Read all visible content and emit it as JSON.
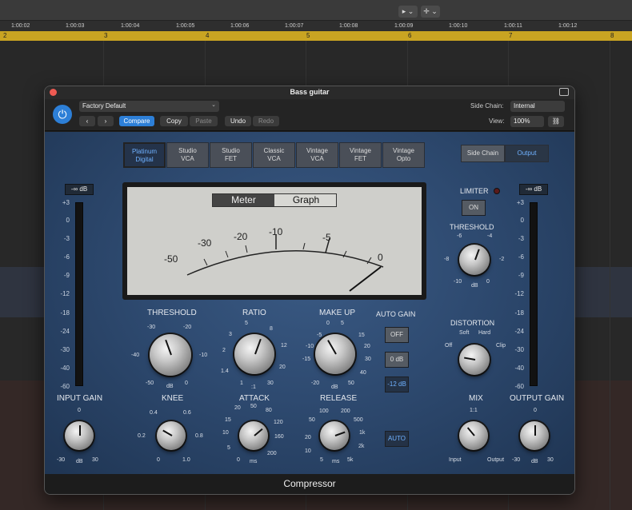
{
  "daw": {
    "tools": [
      "▸ ⌄",
      "✛ ⌄"
    ],
    "timecodes": [
      "1:00:02",
      "1:00:03",
      "1:00:04",
      "1:00:05",
      "1:00:06",
      "1:00:07",
      "1:00:08",
      "1:00:09",
      "1:00:10",
      "1:00:11",
      "1:00:12"
    ],
    "bars": [
      "2",
      "3",
      "4",
      "5",
      "6",
      "7",
      "8"
    ]
  },
  "plugin": {
    "title": "Bass guitar",
    "preset": "Factory Default",
    "nav_prev": "‹",
    "nav_next": "›",
    "compare": "Compare",
    "copy": "Copy",
    "paste": "Paste",
    "undo": "Undo",
    "redo": "Redo",
    "side_chain_label": "Side Chain:",
    "side_chain_value": "Internal",
    "view_label": "View:",
    "view_value": "100%",
    "link_icon": "link-icon",
    "footer": "Compressor",
    "models": [
      {
        "line1": "Platinum",
        "line2": "Digital",
        "active": true
      },
      {
        "line1": "Studio",
        "line2": "VCA",
        "active": false
      },
      {
        "line1": "Studio",
        "line2": "FET",
        "active": false
      },
      {
        "line1": "Classic",
        "line2": "VCA",
        "active": false
      },
      {
        "line1": "Vintage",
        "line2": "VCA",
        "active": false
      },
      {
        "line1": "Vintage",
        "line2": "FET",
        "active": false
      },
      {
        "line1": "Vintage",
        "line2": "Opto",
        "active": false
      }
    ],
    "side_chain_tab": "Side Chain",
    "output_tab": "Output",
    "meter": {
      "tab_meter": "Meter",
      "tab_graph": "Graph",
      "scale": [
        "-50",
        "-30",
        "-20",
        "-10",
        "-5",
        "0"
      ]
    },
    "input_db": "-∞ dB",
    "output_db": "-∞ dB",
    "db_scale": [
      "+3",
      "0",
      "-3",
      "-6",
      "-9",
      "-12",
      "-18",
      "-24",
      "-30",
      "-40",
      "-60"
    ],
    "limiter": {
      "label": "LIMITER",
      "button": "ON"
    },
    "auto_gain": {
      "label": "AUTO GAIN",
      "off": "OFF",
      "zero": "0 dB",
      "minus12": "-12 dB",
      "auto": "AUTO"
    },
    "knobs": {
      "threshold": {
        "label": "THRESHOLD",
        "ticks": [
          "-30",
          "-20",
          "-40",
          "-10",
          "-50",
          "0",
          "dB"
        ]
      },
      "ratio": {
        "label": "RATIO",
        "ticks": [
          "5",
          "3",
          "8",
          "2",
          "12",
          "1.4",
          "20",
          "1",
          "30",
          ":1"
        ]
      },
      "makeup": {
        "label": "MAKE UP",
        "ticks": [
          "0",
          "5",
          "10",
          "-5",
          "15",
          "-10",
          "20",
          "-15",
          "30",
          "-20",
          "40",
          "50",
          "dB"
        ]
      },
      "knee": {
        "label": "KNEE",
        "ticks": [
          "0.4",
          "0.6",
          "0.2",
          "0.8",
          "0",
          "1.0"
        ]
      },
      "attack": {
        "label": "ATTACK",
        "ticks": [
          "20",
          "50",
          "80",
          "15",
          "120",
          "10",
          "160",
          "5",
          "200",
          "0",
          "ms"
        ]
      },
      "release": {
        "label": "RELEASE",
        "ticks": [
          "100",
          "200",
          "50",
          "500",
          "20",
          "1k",
          "10",
          "2k",
          "5",
          "5k",
          "ms"
        ]
      },
      "input_gain": {
        "label": "INPUT GAIN",
        "ticks": [
          "0",
          "-30",
          "30",
          "dB"
        ]
      },
      "output_gain": {
        "label": "OUTPUT GAIN",
        "ticks": [
          "0",
          "-30",
          "30",
          "dB"
        ]
      },
      "lim_threshold": {
        "label": "THRESHOLD",
        "ticks": [
          "-6",
          "-4",
          "-8",
          "-2",
          "-10",
          "0",
          "dB"
        ]
      },
      "distortion": {
        "label": "DISTORTION",
        "ticks": [
          "Soft",
          "Hard",
          "Off",
          "Clip"
        ]
      },
      "mix": {
        "label": "MIX",
        "ticks": [
          "1:1",
          "Input",
          "Output"
        ]
      }
    }
  },
  "colors": {
    "accent": "#2d7fd7",
    "panel": "#2e4a70",
    "cycle": "#c9a422"
  }
}
